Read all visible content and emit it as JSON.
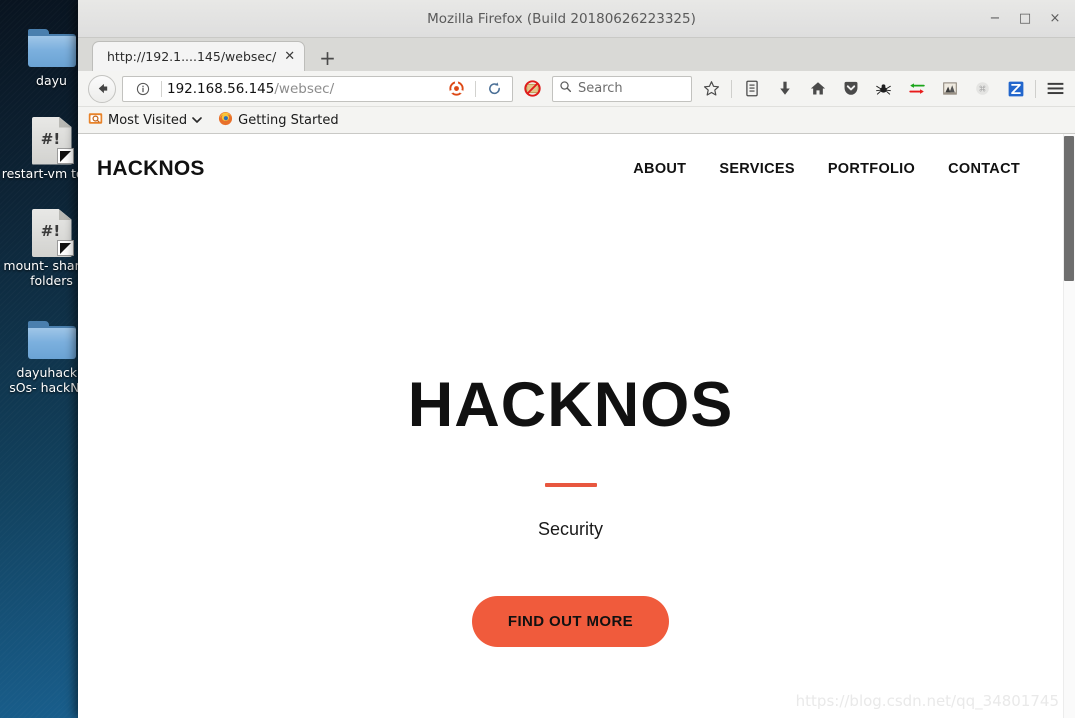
{
  "desktop": {
    "icons": [
      {
        "label": "dayu",
        "type": "folder"
      },
      {
        "label": "restart-vm\ntools",
        "type": "script"
      },
      {
        "label": "mount-\nshared-\nfolders",
        "type": "script"
      },
      {
        "label": "dayuhackN\nsOs-\nhackNos",
        "type": "folder"
      }
    ]
  },
  "window": {
    "title": "Mozilla Firefox (Build 20180626223325)",
    "minimize_label": "−",
    "maximize_label": "□",
    "close_label": "×"
  },
  "tabs": {
    "active_title": "http://192.1....145/websec/",
    "close_label": "✕",
    "newtab_label": "+"
  },
  "navbar": {
    "url_host": "192.168.56.145",
    "url_path": "/websec/",
    "icons": [
      "back-arrow-icon",
      "page-info-icon",
      "ubuntu-identity-icon",
      "reload-icon",
      "noscript-icon",
      "bookmark-star-icon",
      "library-icon",
      "downloads-icon",
      "home-icon",
      "pocket-icon",
      "hackbar-spider-icon",
      "proxy-switch-icon",
      "extension-icon",
      "disabled-addon-icon",
      "zotero-icon",
      "menu-hamburger-icon"
    ]
  },
  "search": {
    "placeholder": "Search"
  },
  "bookmarks": [
    {
      "label": "Most Visited",
      "icon": "most-visited-folder-icon",
      "has_chevron": true
    },
    {
      "label": "Getting Started",
      "icon": "firefox-icon",
      "has_chevron": false
    }
  ],
  "page": {
    "logo": "HACKNOS",
    "nav": [
      {
        "label": "ABOUT"
      },
      {
        "label": "SERVICES"
      },
      {
        "label": "PORTFOLIO"
      },
      {
        "label": "CONTACT"
      }
    ],
    "hero": {
      "title": "HACKNOS",
      "subtitle": "Security",
      "cta_label": "FIND OUT MORE"
    },
    "watermark": "https://blog.csdn.net/qq_34801745",
    "accent_color": "#f05b3c",
    "divider_color": "#e8573f"
  }
}
